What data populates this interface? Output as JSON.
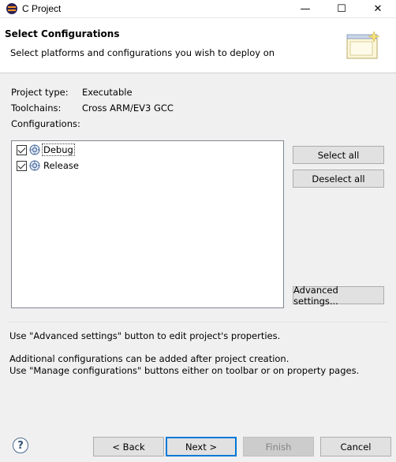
{
  "window": {
    "title": "C Project",
    "minimize_glyph": "—",
    "maximize_glyph": "☐",
    "close_glyph": "✕"
  },
  "header": {
    "title": "Select Configurations",
    "description": "Select platforms and configurations you wish to deploy on"
  },
  "info": {
    "project_type_label": "Project type:",
    "project_type_value": "Executable",
    "toolchains_label": "Toolchains:",
    "toolchains_value": "Cross ARM/EV3 GCC",
    "configurations_label": "Configurations:"
  },
  "configurations": [
    {
      "label": "Debug",
      "checked": true,
      "focused": true
    },
    {
      "label": "Release",
      "checked": true,
      "focused": false
    }
  ],
  "side_buttons": {
    "select_all": "Select all",
    "deselect_all": "Deselect all",
    "advanced": "Advanced settings..."
  },
  "messages": {
    "line1": "Use \"Advanced settings\" button to edit project's properties.",
    "line2": "Additional configurations can be added after project creation.",
    "line3": "Use \"Manage configurations\" buttons either on toolbar or on property pages."
  },
  "footer": {
    "help_glyph": "?",
    "back": "< Back",
    "next": "Next >",
    "finish": "Finish",
    "cancel": "Cancel"
  },
  "colors": {
    "accent": "#0078d7",
    "icon_purple": "#2c2255",
    "icon_orange": "#f7941e"
  }
}
